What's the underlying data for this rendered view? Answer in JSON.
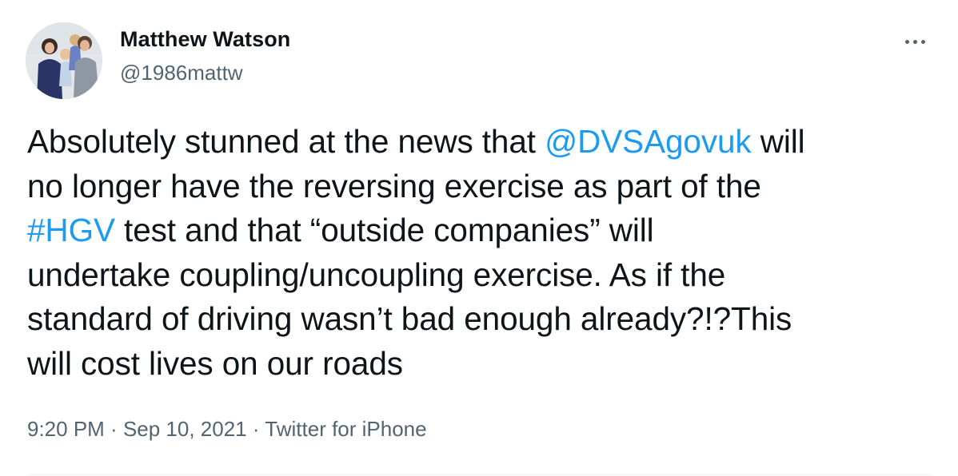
{
  "author": {
    "display_name": "Matthew Watson",
    "handle": "@1986mattw",
    "avatar_icon": "profile-photo-avatar"
  },
  "more_icon": "more-horizontal-icon",
  "tweet": {
    "segments": [
      {
        "text": "Absolutely stunned at the news that ",
        "type": "text"
      },
      {
        "text": "@DVSAgovuk",
        "type": "mention"
      },
      {
        "text": " will\nno longer have the reversing exercise as part of the\n",
        "type": "text"
      },
      {
        "text": "#HGV",
        "type": "hashtag"
      },
      {
        "text": " test and that “outside companies” will\nundertake coupling/uncoupling exercise. As if the\nstandard of driving wasn’t bad enough already?!?This\nwill cost lives on our roads",
        "type": "text"
      }
    ]
  },
  "meta": {
    "time": "9:20 PM",
    "separator": " · ",
    "date": "Sep 10, 2021",
    "source": "Twitter for iPhone"
  },
  "colors": {
    "link": "#1d9bf0",
    "secondary_text": "#536471",
    "primary_text": "#0f1419",
    "divider": "#eff3f4"
  }
}
